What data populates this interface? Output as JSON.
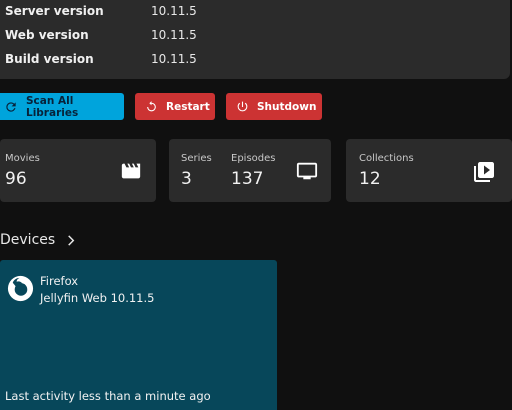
{
  "server_info": {
    "rows": [
      {
        "label": "Server version",
        "value": "10.11.5"
      },
      {
        "label": "Web version",
        "value": "10.11.5"
      },
      {
        "label": "Build version",
        "value": "10.11.5"
      }
    ]
  },
  "actions": {
    "scan_label": "Scan All Libraries",
    "restart_label": "Restart",
    "shutdown_label": "Shutdown",
    "colors": {
      "scan": "#00a4dc",
      "danger": "#cc3333"
    }
  },
  "stats": {
    "movies": {
      "label": "Movies",
      "value": "96",
      "icon": "movie-clapper-icon"
    },
    "series": {
      "label": "Series",
      "value": "3"
    },
    "episodes": {
      "label": "Episodes",
      "value": "137",
      "icon": "tv-icon"
    },
    "collections": {
      "label": "Collections",
      "value": "12",
      "icon": "video-library-icon"
    }
  },
  "devices": {
    "heading": "Devices",
    "items": [
      {
        "name": "Firefox",
        "app": "Jellyfin Web 10.11.5",
        "activity": "Last activity less than a minute ago",
        "icon": "firefox-icon",
        "card_color": "#07475a"
      }
    ]
  }
}
